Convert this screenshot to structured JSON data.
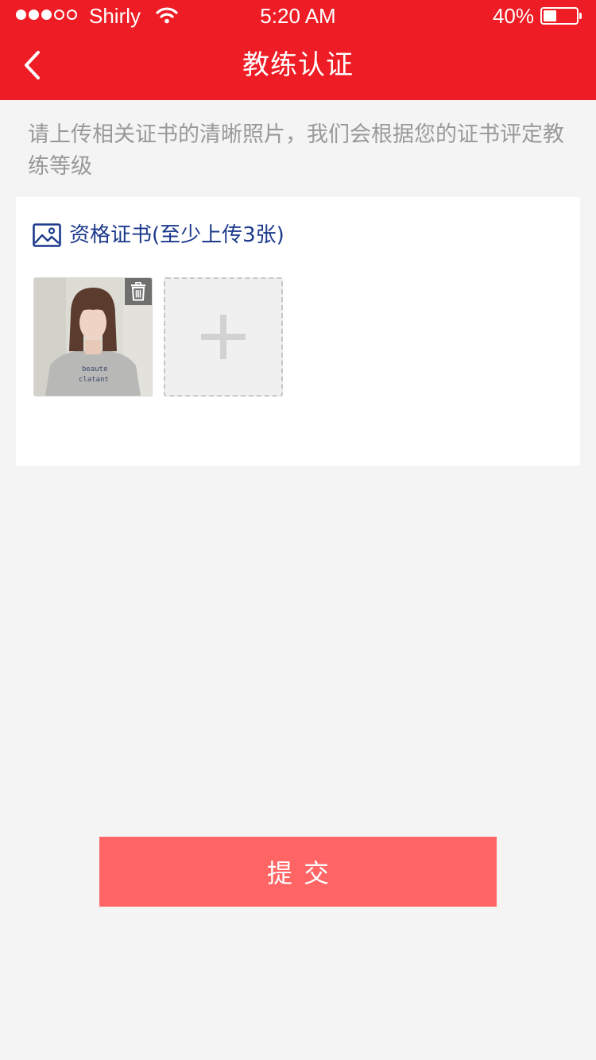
{
  "status_bar": {
    "carrier": "Shirly",
    "time": "5:20 AM",
    "battery_percent": "40%",
    "signal_bars_filled": 3,
    "signal_bars_total": 5,
    "battery_level": 0.4
  },
  "nav": {
    "title": "教练认证",
    "back_icon": "chevron-left-icon"
  },
  "hint": "请上传相关证书的清晰照片，我们会根据您的证书评定教练等级",
  "certificate": {
    "icon": "image-icon",
    "title": "资格证书(至少上传3张)",
    "delete_icon": "trash-icon",
    "add_icon": "plus-icon"
  },
  "submit_label": "提交",
  "colors": {
    "header": "#ee1c25",
    "submit": "#ff6565",
    "card_title": "#1b3a8c",
    "hint": "#999999",
    "background": "#f4f4f4"
  }
}
